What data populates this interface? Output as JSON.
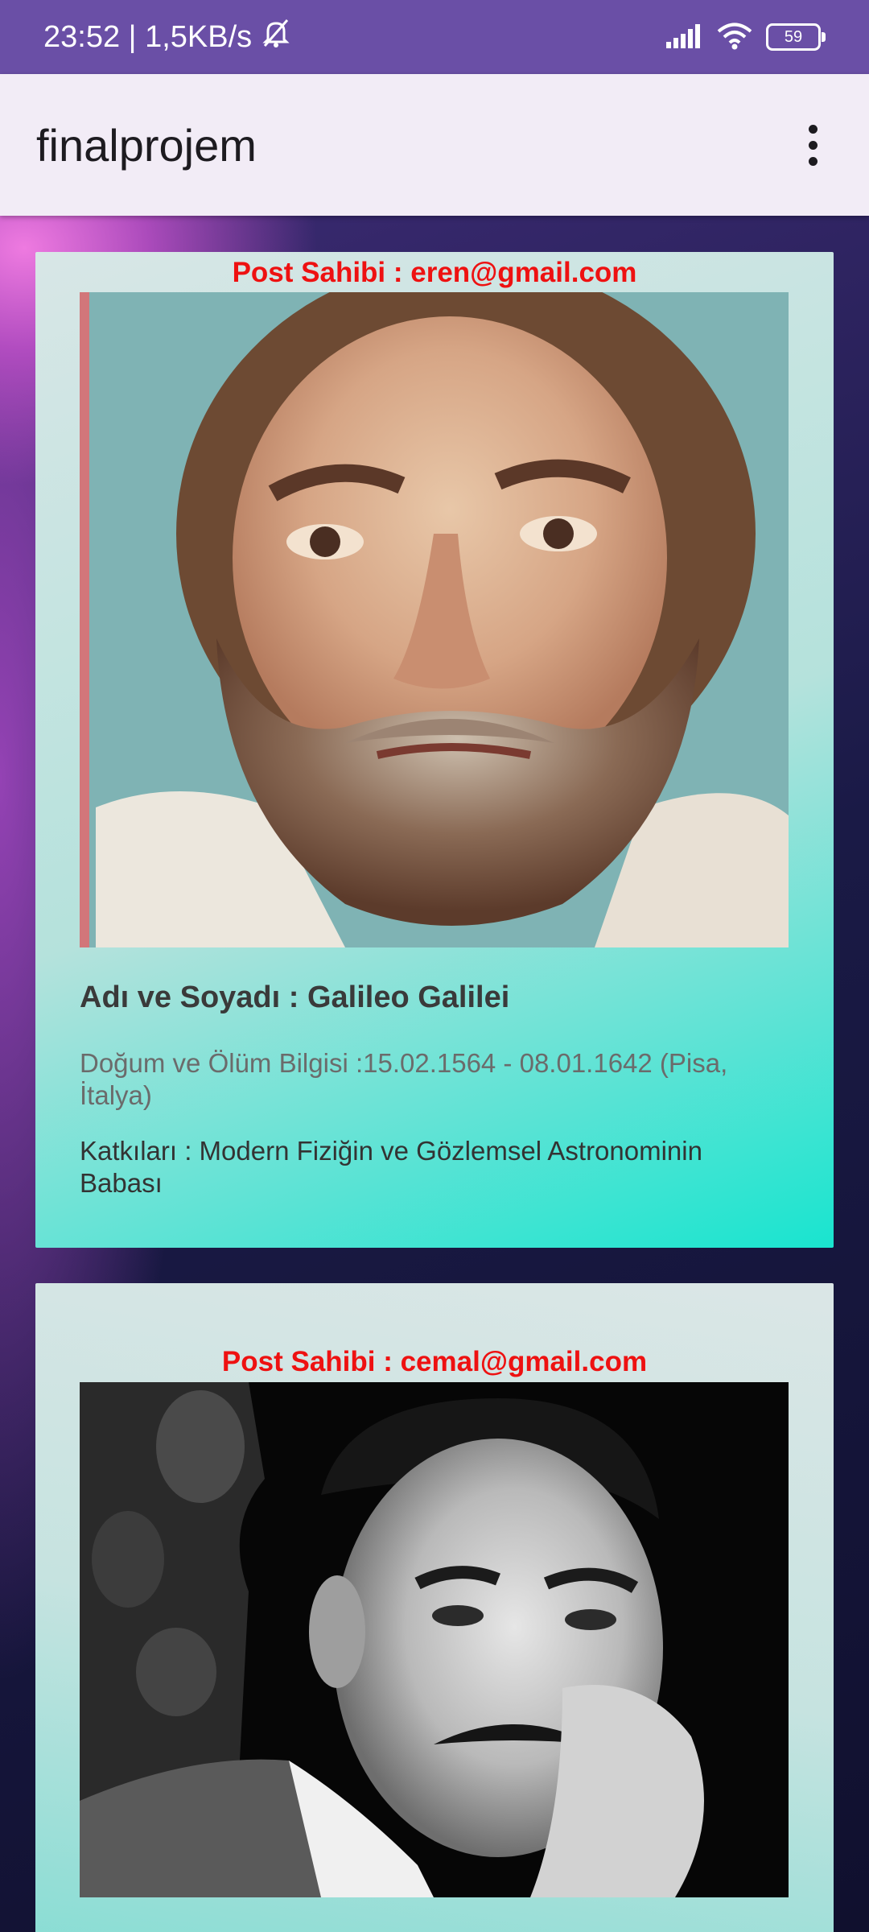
{
  "status_bar": {
    "time_speed": "23:52 | 1,5KB/s",
    "battery": "59",
    "icons": [
      "mute-notifications-icon",
      "signal-icon",
      "wifi-icon",
      "battery-icon"
    ]
  },
  "app_bar": {
    "title": "finalprojem",
    "menu_icon": "more-vert-icon"
  },
  "posts": [
    {
      "owner": "Post Sahibi : eren@gmail.com",
      "image": "portrait-galileo",
      "name": "Adı ve Soyadı : Galileo Galilei",
      "birth_death": "Doğum ve Ölüm Bilgisi :15.02.1564 - 08.01.1642 (Pisa, İtalya)",
      "contributions": "Katkıları : Modern Fiziğin ve Gözlemsel Astronominin Babası"
    },
    {
      "owner": "Post Sahibi : cemal@gmail.com",
      "image": "portrait-tesla"
    }
  ],
  "colors": {
    "status_bar": "#6a4fa6",
    "app_bar": "#f2ecf6",
    "owner_text": "#ee1111",
    "card_gradient_end": "#19e4cf"
  }
}
